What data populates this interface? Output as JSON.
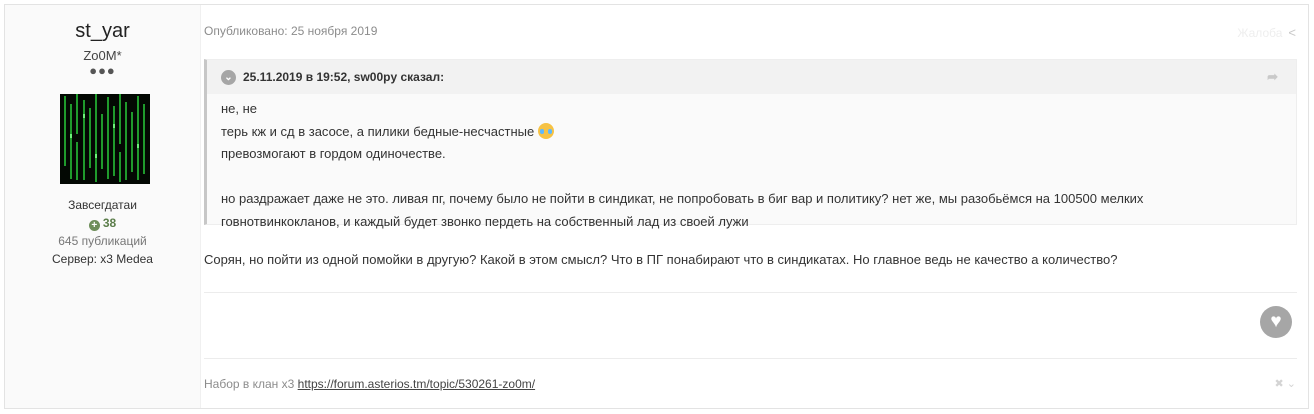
{
  "author": {
    "name": "st_yar",
    "title": "Zo0M*",
    "pips": "●●●",
    "group": "Завсегдатаи",
    "reputation": "38",
    "posts": "645 публикаций",
    "server": "Сервер: x3 Medea"
  },
  "post": {
    "published": "Опубликовано: 25 ноября 2019",
    "report_label": "Жалоба",
    "quote": {
      "header": "25.11.2019 в 19:52, sw00py сказал:",
      "lines": [
        "не, не",
        "терь кж и сд в засосе, а пилики бедные-несчастные",
        "превозмогают в гордом одиночестве.",
        "",
        "но раздражает даже не это. ливая пг, почему было не пойти в синдикат, не попробовать в биг вар и политику? нет же, мы разобьёмся на 100500 мелких",
        "говнотвинкокланов, и каждый будет звонко пердеть на собственный лад из своей лужи"
      ]
    },
    "reply": "Сорян, но пойти из одной помойки в другую? Какой в этом смысл? Что в ПГ понабирают что в синдикатах. Но главное ведь не качество а количество?"
  },
  "signature": {
    "text": "Набор в клан x3 ",
    "link": "https://forum.asterios.tm/topic/530261-zo0m/"
  },
  "icons": {
    "toggle": "chevron-down-icon",
    "share": "share-icon",
    "like": "heart-icon",
    "close": "close-icon",
    "reputation": "plus-circle-icon",
    "emoji": "laughing-tears-emoji"
  },
  "colors": {
    "reputation": "#5b7d4a",
    "meta": "#8c8c8c",
    "quote_border": "#c7c7c7"
  }
}
